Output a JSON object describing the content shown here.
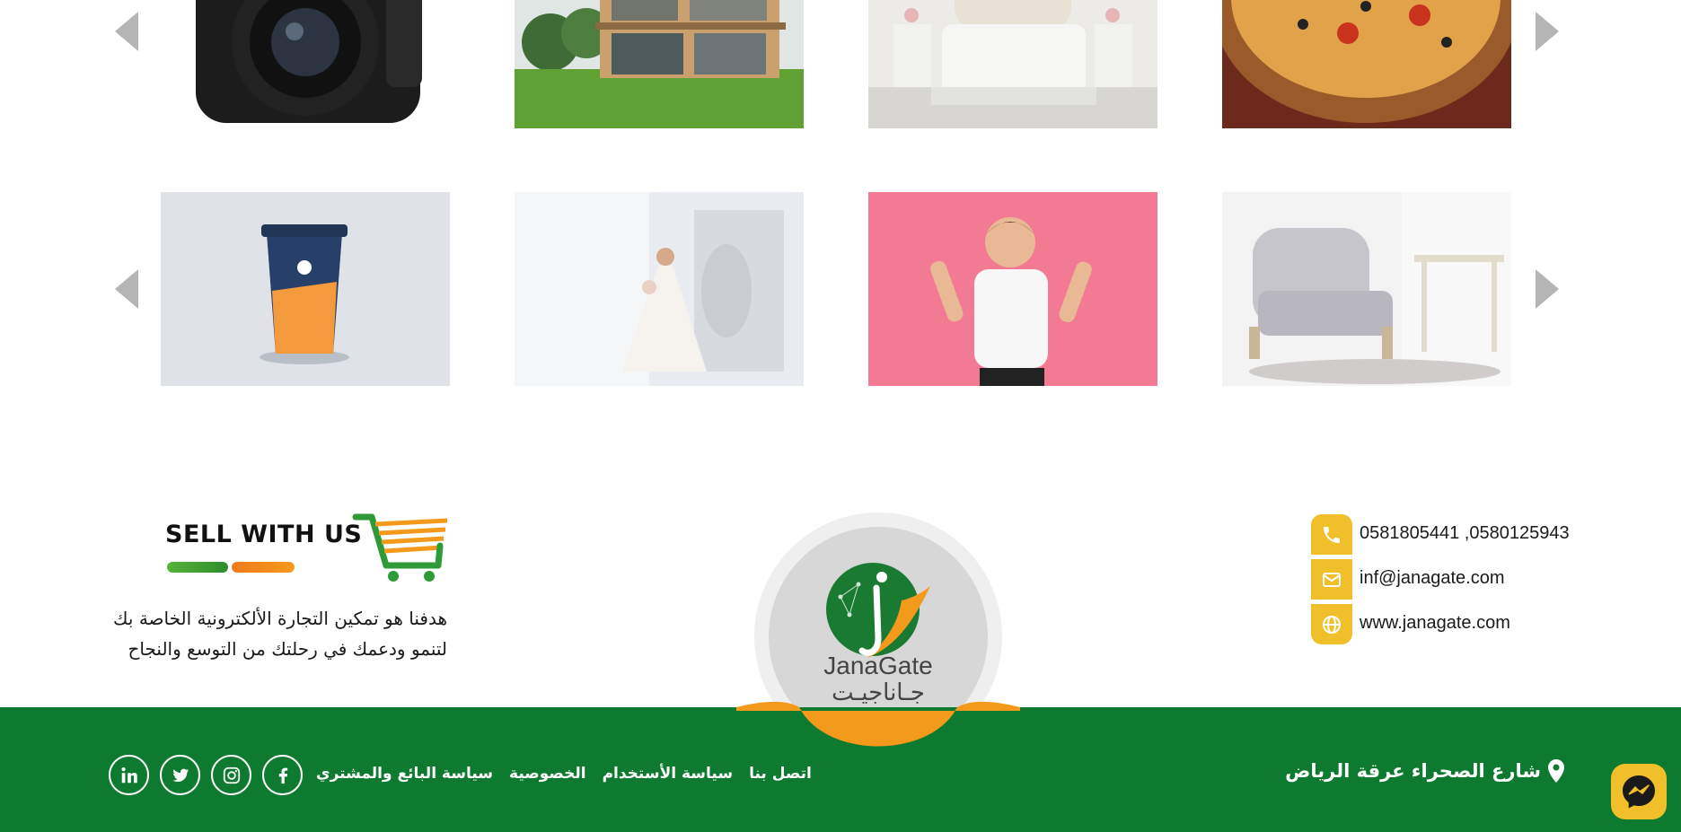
{
  "gallery": {
    "row1": [
      {
        "icon": "camera-photo"
      },
      {
        "icon": "house-photo"
      },
      {
        "icon": "bedroom-photo"
      },
      {
        "icon": "pizza-photo"
      }
    ],
    "row2": [
      {
        "icon": "coffee-cup-photo"
      },
      {
        "icon": "bride-photo"
      },
      {
        "icon": "happy-boy-photo"
      },
      {
        "icon": "armchair-photo"
      }
    ]
  },
  "contact": {
    "phone": "0581805441 ,0580125943",
    "email": "inf@janagate.com",
    "website": "www.janagate.com",
    "icons": [
      "phone-icon",
      "mail-icon",
      "globe-icon"
    ]
  },
  "logo": {
    "name_en": "JanaGate",
    "name_ar": "جـاناجيـت"
  },
  "sell_banner": {
    "text": "SELL WITH US"
  },
  "about": {
    "text": "هدفنا هو تمكين التجارة الألكترونية الخاصة بك لتنمو ودعمك في رحلتك من التوسع والنجاح"
  },
  "footer": {
    "address": "شارع الصحراء عرقة الرياض",
    "links": [
      "سياسة البائع والمشتري",
      "الخصوصية",
      "سياسة الأستخدام",
      "اتصل بنا"
    ],
    "social_icons": [
      "facebook-icon",
      "instagram-icon",
      "twitter-icon",
      "linkedin-icon"
    ]
  },
  "colors": {
    "brand_green": "#0e7a2f",
    "accent_yellow": "#f1bf2a",
    "accent_orange": "#f39a1d"
  }
}
